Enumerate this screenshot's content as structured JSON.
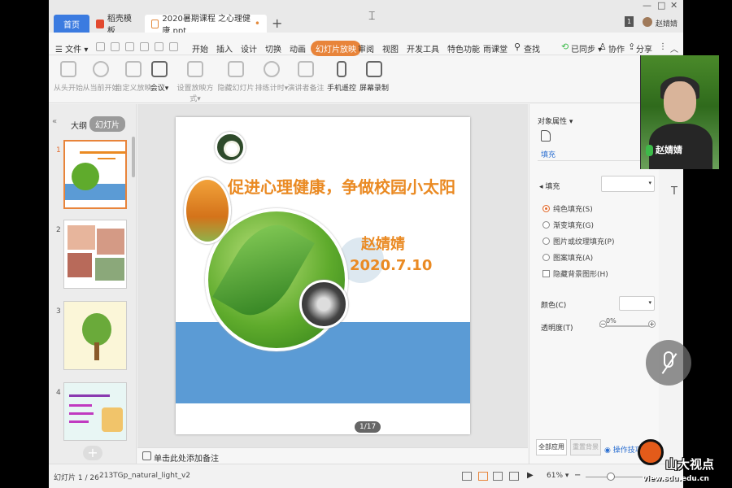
{
  "window": {
    "tabs": [
      {
        "label": "首页"
      },
      {
        "label": "稻壳模板"
      },
      {
        "label": "2020暑期课程 之心理健康.ppt"
      }
    ],
    "tab_add": "+",
    "user_name": "赵婧婧",
    "user_badge": "1",
    "controls": {
      "min": "—",
      "max": "□",
      "close": "✕"
    }
  },
  "menubar": {
    "file": "☰ 文件 ▾",
    "items": [
      "开始",
      "插入",
      "设计",
      "切换",
      "动画",
      "幻灯片放映",
      "审阅",
      "视图",
      "开发工具",
      "特色功能",
      "雨课堂",
      "查找"
    ],
    "active": "幻灯片放映",
    "sync": "已同步 ▾",
    "collab": "协作",
    "share": "分享"
  },
  "ribbon": {
    "buttons": [
      {
        "label": "从头开始",
        "enabled": false
      },
      {
        "label": "从当前开始",
        "enabled": false
      },
      {
        "label": "自定义放映",
        "enabled": false
      },
      {
        "label": "会议▾",
        "enabled": true
      },
      {
        "label": "设置放映方式▾",
        "enabled": false
      },
      {
        "label": "隐藏幻灯片",
        "enabled": false
      },
      {
        "label": "排练计时▾",
        "enabled": false
      },
      {
        "label": "演讲者备注",
        "enabled": false
      },
      {
        "label": "手机遥控",
        "enabled": true
      },
      {
        "label": "屏幕录制",
        "enabled": true
      }
    ]
  },
  "left_panel": {
    "outline_tab": "大纲",
    "slides_tab": "幻灯片",
    "collapse": "«",
    "add_button": "+",
    "thumbnails": [
      {
        "num": "1",
        "selected": true
      },
      {
        "num": "2",
        "selected": false
      },
      {
        "num": "3",
        "selected": false
      },
      {
        "num": "4",
        "selected": false
      }
    ]
  },
  "slide": {
    "title": "促进心理健康，争做校园小太阳",
    "author": "赵婧婧",
    "date": "2020.7.10",
    "page_indicator": "1/17"
  },
  "notes": {
    "placeholder": "单击此处添加备注"
  },
  "right_panel": {
    "title": "对象属性 ▾",
    "tab": "填充",
    "fill_label": "◂ 填充",
    "options": [
      {
        "label": "纯色填充(S)",
        "type": "radio",
        "checked": true
      },
      {
        "label": "渐变填充(G)",
        "type": "radio",
        "checked": false
      },
      {
        "label": "图片或纹理填充(P)",
        "type": "radio",
        "checked": false
      },
      {
        "label": "图案填充(A)",
        "type": "radio",
        "checked": false
      },
      {
        "label": "隐藏背景图形(H)",
        "type": "checkbox",
        "checked": false
      }
    ],
    "color_label": "颜色(C)",
    "transparency_label": "透明度(T)",
    "transparency_value": "0%",
    "apply_all": "全部应用",
    "reset_bg": "重置背景",
    "tips": "操作技巧"
  },
  "statusbar": {
    "slide_count": "幻灯片 1 / 26",
    "theme": "213TGp_natural_light_v2",
    "zoom": "61% ▾"
  },
  "webcam": {
    "name": "赵婧婧"
  },
  "watermark": {
    "name": "山大视点",
    "url": "view.sdu.edu.cn"
  },
  "colors": {
    "accent": "#e8843a",
    "blue": "#3b7be0",
    "slide_band": "#5b9bd5",
    "title_orange": "#ea8a23"
  }
}
